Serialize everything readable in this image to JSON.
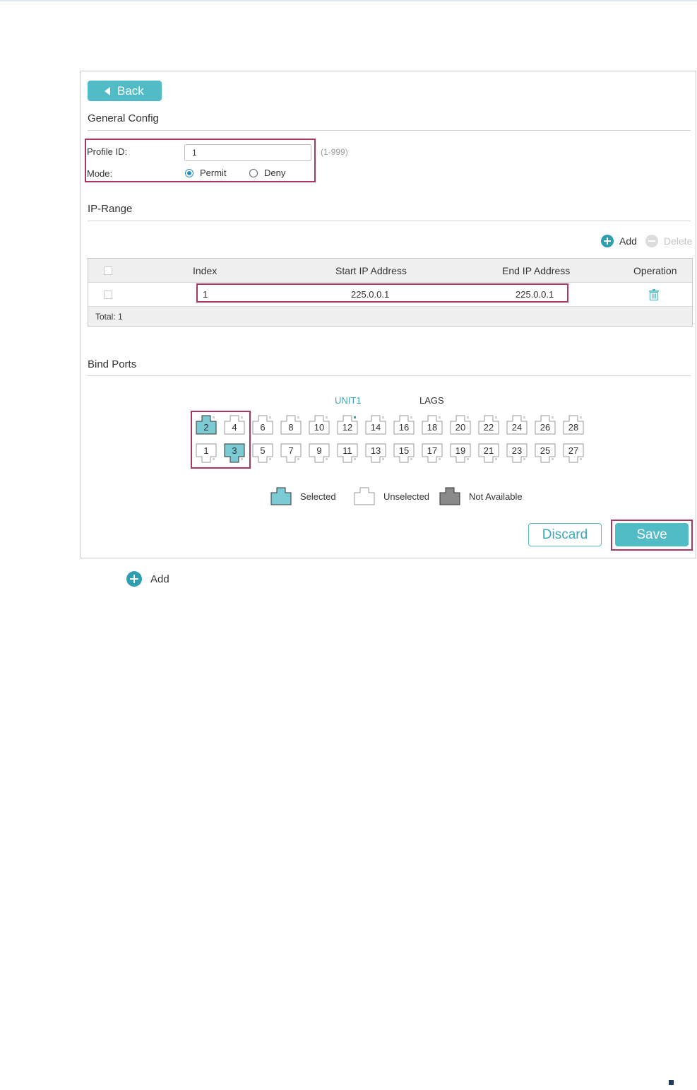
{
  "back_label": "Back",
  "general_config": {
    "title": "General Config",
    "profile_id_label": "Profile ID:",
    "profile_id_value": "1",
    "profile_id_hint": "(1-999)",
    "mode_label": "Mode:",
    "mode_options": [
      "Permit",
      "Deny"
    ],
    "mode_selected": "Permit"
  },
  "ip_range": {
    "title": "IP-Range",
    "add_label": "Add",
    "delete_label": "Delete",
    "columns": [
      "Index",
      "Start IP Address",
      "End IP Address",
      "Operation"
    ],
    "rows": [
      {
        "index": "1",
        "start_ip": "225.0.0.1",
        "end_ip": "225.0.0.1"
      }
    ],
    "total_label": "Total: 1"
  },
  "bind_ports": {
    "title": "Bind Ports",
    "tabs": [
      "UNIT1",
      "LAGS"
    ],
    "active_tab": "UNIT1",
    "top_row": [
      "2",
      "4",
      "6",
      "8",
      "10",
      "12",
      "14",
      "16",
      "18",
      "20",
      "22",
      "24",
      "26",
      "28"
    ],
    "bottom_row": [
      "1",
      "3",
      "5",
      "7",
      "9",
      "11",
      "13",
      "15",
      "17",
      "19",
      "21",
      "23",
      "25",
      "27"
    ],
    "selected": [
      "2",
      "3"
    ],
    "legend": [
      "Selected",
      "Unselected",
      "Not Available"
    ]
  },
  "buttons": {
    "discard": "Discard",
    "save": "Save"
  },
  "footer_add_label": "Add",
  "colors": {
    "accent": "#51bbc6",
    "highlight_box": "#a8365d",
    "selected_port": "#7ccbd4",
    "unavailable_port": "#8a8a8a",
    "radio": "#2d8fc0"
  },
  "icons": [
    "back-arrow-icon",
    "add-circle-icon",
    "delete-circle-icon",
    "trash-icon",
    "port-icon"
  ]
}
